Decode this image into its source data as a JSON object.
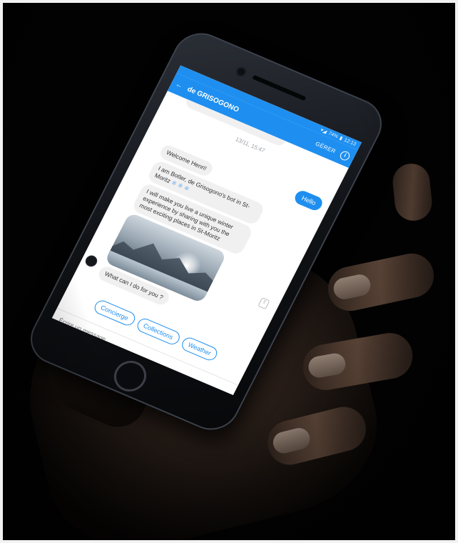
{
  "colors": {
    "accent": "#1e8ff0",
    "bubble_in": "#f1f0f0",
    "background": "#000000"
  },
  "status_bar": {
    "battery": "74%",
    "time": "12:13"
  },
  "app_bar": {
    "back_icon": "arrow-left-icon",
    "title": "de GRISOGONO",
    "manage_label": "GÉRER",
    "info_icon": "info-icon"
  },
  "chat": {
    "timestamp": "13/11, 15:47",
    "outgoing": [
      {
        "text": "Hello"
      }
    ],
    "incoming": [
      {
        "text": "Welcome Henri!"
      },
      {
        "text": "I am Botler, de Grisogono's bot in St-Moritz",
        "emoji": "❄ ❄ ❄"
      },
      {
        "text": "I will make you live a unique winter experience by sharing with you the most exciting places in St-Moritz"
      },
      {
        "text": "What can I do for you ?"
      }
    ],
    "image_alt": "snowy mountains"
  },
  "quick_replies": [
    "Concierge",
    "Collections",
    "Weather"
  ],
  "composer": {
    "placeholder": "Écrire un message..."
  }
}
